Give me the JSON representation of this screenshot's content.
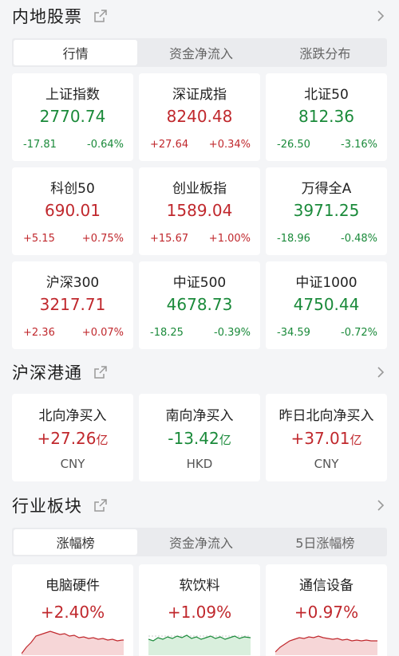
{
  "colors": {
    "up": "#c0282d",
    "down": "#1a8a3a"
  },
  "mainland": {
    "title": "内地股票",
    "tabs": [
      "行情",
      "资金净流入",
      "涨跌分布"
    ],
    "indices": [
      {
        "name": "上证指数",
        "value": "2770.74",
        "change": "-17.81",
        "pct": "-0.64%",
        "dir": "down"
      },
      {
        "name": "深证成指",
        "value": "8240.48",
        "change": "+27.64",
        "pct": "+0.34%",
        "dir": "up"
      },
      {
        "name": "北证50",
        "value": "812.36",
        "change": "-26.50",
        "pct": "-3.16%",
        "dir": "down"
      },
      {
        "name": "科创50",
        "value": "690.01",
        "change": "+5.15",
        "pct": "+0.75%",
        "dir": "up"
      },
      {
        "name": "创业板指",
        "value": "1589.04",
        "change": "+15.67",
        "pct": "+1.00%",
        "dir": "up"
      },
      {
        "name": "万得全A",
        "value": "3971.25",
        "change": "-18.96",
        "pct": "-0.48%",
        "dir": "down"
      },
      {
        "name": "沪深300",
        "value": "3217.71",
        "change": "+2.36",
        "pct": "+0.07%",
        "dir": "up"
      },
      {
        "name": "中证500",
        "value": "4678.73",
        "change": "-18.25",
        "pct": "-0.39%",
        "dir": "down"
      },
      {
        "name": "中证1000",
        "value": "4750.44",
        "change": "-34.59",
        "pct": "-0.72%",
        "dir": "down"
      }
    ]
  },
  "connect": {
    "title": "沪深港通",
    "flows": [
      {
        "name": "北向净买入",
        "value": "+27.26",
        "unit": "亿",
        "currency": "CNY",
        "dir": "up"
      },
      {
        "name": "南向净买入",
        "value": "-13.42",
        "unit": "亿",
        "currency": "HKD",
        "dir": "down"
      },
      {
        "name": "昨日北向净买入",
        "value": "+37.01",
        "unit": "亿",
        "currency": "CNY",
        "dir": "up"
      }
    ]
  },
  "sectors": {
    "title": "行业板块",
    "tabs": [
      "涨幅榜",
      "资金净流入",
      "5日涨幅榜"
    ],
    "items": [
      {
        "name": "电脑硬件",
        "pct": "+2.40%",
        "dir": "up"
      },
      {
        "name": "软饮料",
        "pct": "+1.09%",
        "dir": "down"
      },
      {
        "name": "通信设备",
        "pct": "+0.97%",
        "dir": "up"
      }
    ]
  }
}
